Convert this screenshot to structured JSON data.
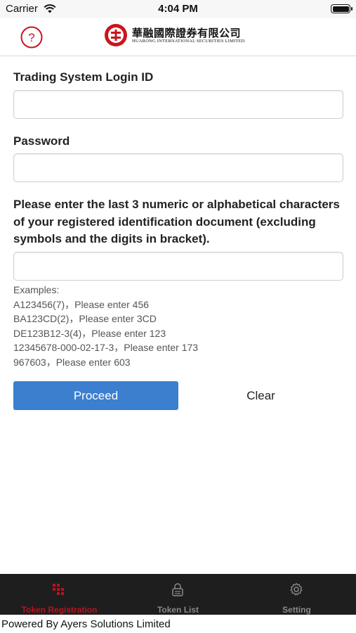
{
  "status_bar": {
    "carrier": "Carrier",
    "time": "4:04 PM",
    "icons": [
      "wifi-icon",
      "battery-icon"
    ]
  },
  "header": {
    "help_icon": "question-circle-icon",
    "logo_chinese": "華融國際證券有限公司",
    "logo_english": "HUARONG INTERNATIONAL SECURITIES LIMITED",
    "brand_color": "#c8161d"
  },
  "form": {
    "login_id_label": "Trading System Login ID",
    "login_id_value": "",
    "password_label": "Password",
    "password_value": "",
    "id_instruction": "Please enter the last 3 numeric or alphabetical characters of your registered identification document (excluding symbols and the digits in bracket).",
    "id_value": "",
    "examples_heading": "Examples:",
    "examples": [
      "A123456(7)，Please enter 456",
      "BA123CD(2)，Please enter 3CD",
      "DE123B12-3(4)，Please enter 123",
      "12345678-000-02-17-3，Please enter 173",
      "967603，Please enter 603"
    ],
    "proceed_label": "Proceed",
    "clear_label": "Clear",
    "accent_color": "#3b7fce"
  },
  "tabs": [
    {
      "label": "Token Registration",
      "icon": "keypad-icon",
      "active": true
    },
    {
      "label": "Token List",
      "icon": "lock-icon",
      "active": false
    },
    {
      "label": "Setting",
      "icon": "gear-icon",
      "active": false
    }
  ],
  "footer": {
    "text": "Powered By Ayers Solutions Limited"
  }
}
